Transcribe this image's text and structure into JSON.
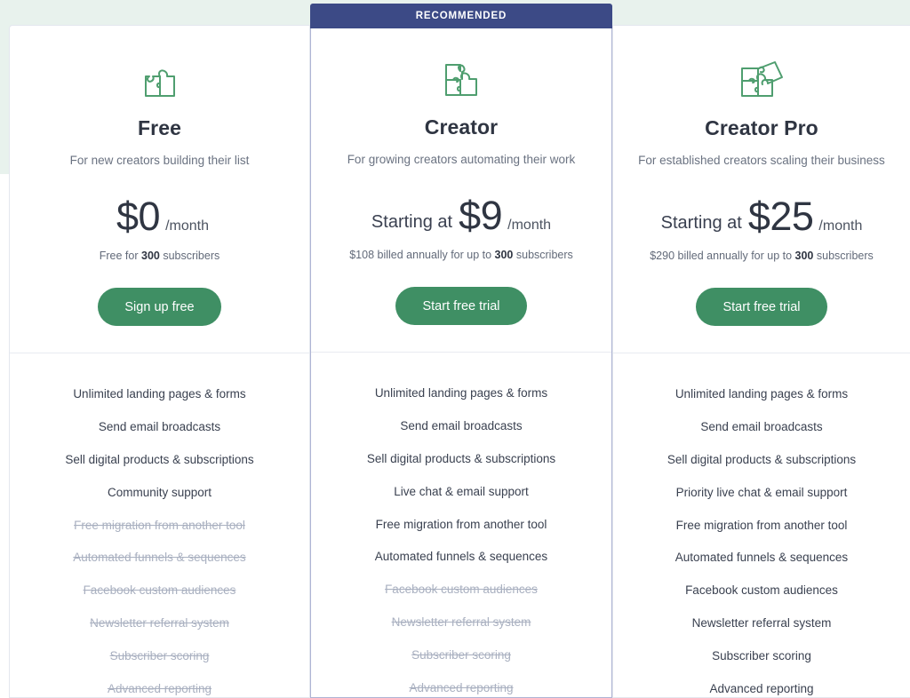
{
  "page": {
    "background_color": "#ffffff",
    "accent_green": "#3f8f64",
    "ribbon_color": "#3c4a86",
    "band_color": "#e8f2ed"
  },
  "plans": [
    {
      "id": "free",
      "ribbon": null,
      "icon": "puzzle-two-pieces-icon",
      "name": "Free",
      "tagline": "For new creators building their list",
      "price_prefix": "",
      "price_amount": "$0",
      "price_period": "/month",
      "price_note_prefix": "Free for ",
      "price_note_bold": "300",
      "price_note_suffix": " subscribers",
      "cta_label": "Sign up free",
      "features": [
        {
          "label": "Unlimited landing pages & forms",
          "included": true
        },
        {
          "label": "Send email broadcasts",
          "included": true
        },
        {
          "label": "Sell digital products & subscriptions",
          "included": true
        },
        {
          "label": "Community support",
          "included": true
        },
        {
          "label": "Free migration from another tool",
          "included": false
        },
        {
          "label": "Automated funnels & sequences",
          "included": false
        },
        {
          "label": "Facebook custom audiences",
          "included": false
        },
        {
          "label": "Newsletter referral system",
          "included": false
        },
        {
          "label": "Subscriber scoring",
          "included": false
        },
        {
          "label": "Advanced reporting",
          "included": false
        }
      ]
    },
    {
      "id": "creator",
      "ribbon": "RECOMMENDED",
      "icon": "puzzle-three-pieces-icon",
      "name": "Creator",
      "tagline": "For growing creators automating their work",
      "price_prefix": "Starting at",
      "price_amount": "$9",
      "price_period": "/month",
      "price_note_prefix": "$108 billed annually for up to ",
      "price_note_bold": "300",
      "price_note_suffix": " subscribers",
      "cta_label": "Start free trial",
      "features": [
        {
          "label": "Unlimited landing pages & forms",
          "included": true
        },
        {
          "label": "Send email broadcasts",
          "included": true
        },
        {
          "label": "Sell digital products & subscriptions",
          "included": true
        },
        {
          "label": "Live chat & email support",
          "included": true
        },
        {
          "label": "Free migration from another tool",
          "included": true
        },
        {
          "label": "Automated funnels & sequences",
          "included": true
        },
        {
          "label": "Facebook custom audiences",
          "included": false
        },
        {
          "label": "Newsletter referral system",
          "included": false
        },
        {
          "label": "Subscriber scoring",
          "included": false
        },
        {
          "label": "Advanced reporting",
          "included": false
        }
      ]
    },
    {
      "id": "creator-pro",
      "ribbon": null,
      "icon": "puzzle-four-pieces-icon",
      "name": "Creator Pro",
      "tagline": "For established creators scaling their business",
      "price_prefix": "Starting at",
      "price_amount": "$25",
      "price_period": "/month",
      "price_note_prefix": "$290 billed annually for up to ",
      "price_note_bold": "300",
      "price_note_suffix": " subscribers",
      "cta_label": "Start free trial",
      "features": [
        {
          "label": "Unlimited landing pages & forms",
          "included": true
        },
        {
          "label": "Send email broadcasts",
          "included": true
        },
        {
          "label": "Sell digital products & subscriptions",
          "included": true
        },
        {
          "label": "Priority live chat & email support",
          "included": true
        },
        {
          "label": "Free migration from another tool",
          "included": true
        },
        {
          "label": "Automated funnels & sequences",
          "included": true
        },
        {
          "label": "Facebook custom audiences",
          "included": true
        },
        {
          "label": "Newsletter referral system",
          "included": true
        },
        {
          "label": "Subscriber scoring",
          "included": true
        },
        {
          "label": "Advanced reporting",
          "included": true
        }
      ]
    }
  ]
}
